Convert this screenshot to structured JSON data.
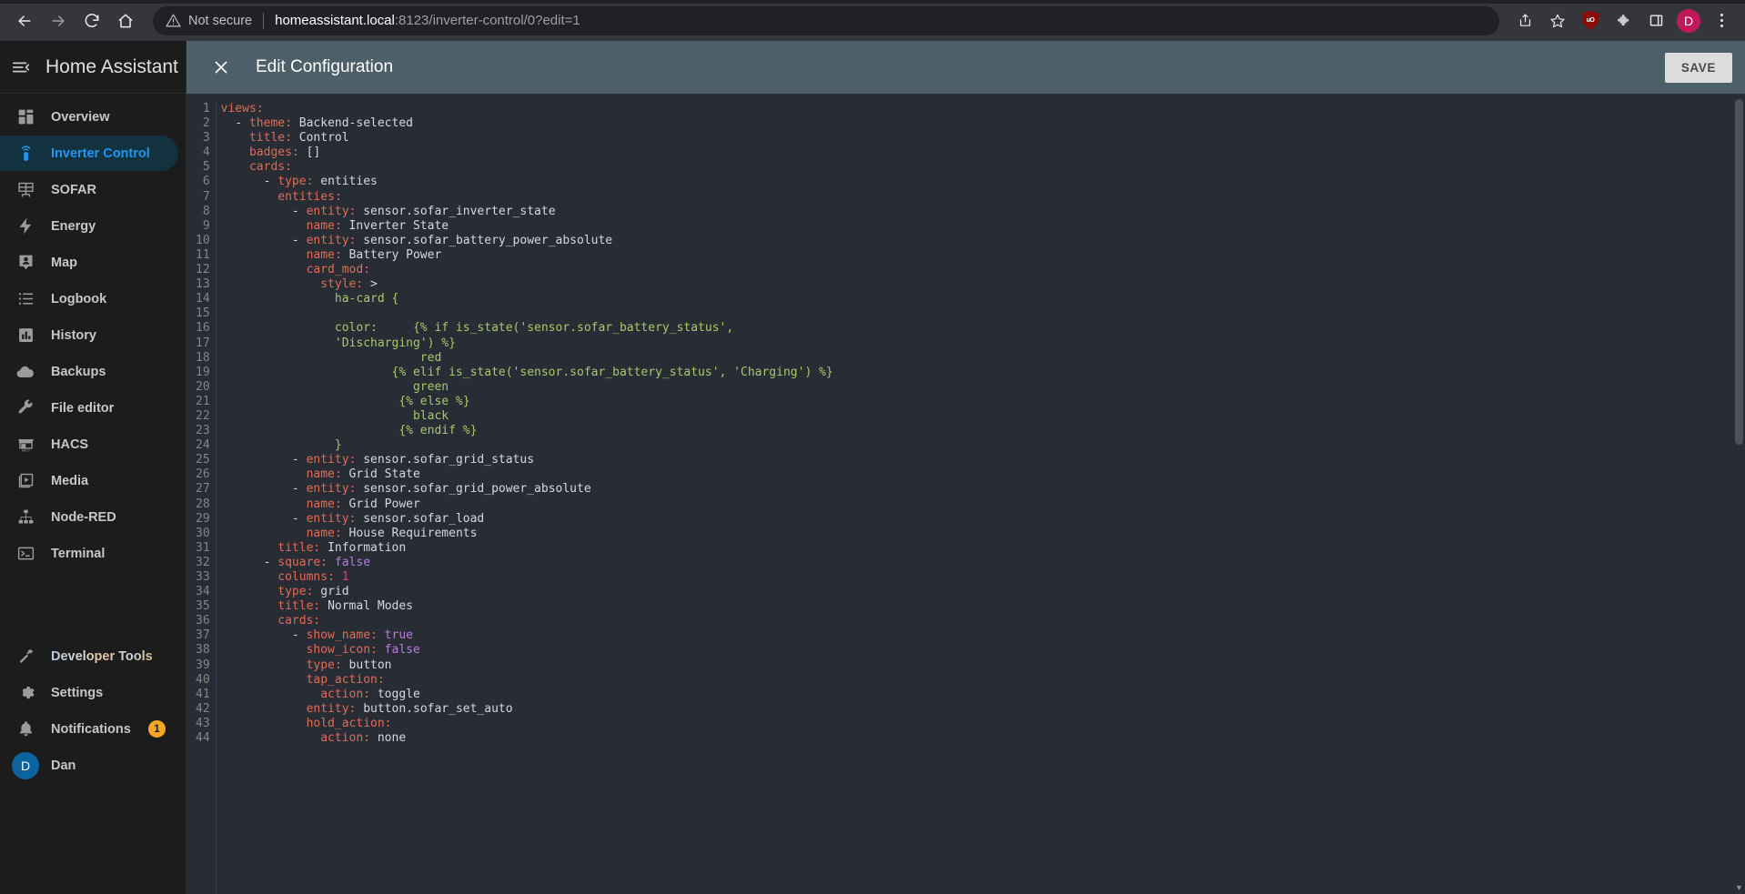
{
  "browser": {
    "back_icon": "arrow-left-icon",
    "forward_icon": "arrow-right-icon",
    "reload_icon": "reload-icon",
    "home_icon": "home-icon",
    "security_label": "Not secure",
    "url_host": "homeassistant.local",
    "url_path": ":8123/inverter-control/0?edit=1",
    "share_icon": "share-icon",
    "bookmark_icon": "star-icon",
    "extension_shield_label": "uO",
    "puzzle_icon": "puzzle-icon",
    "sidepanel_icon": "side-panel-icon",
    "profile_initial": "D",
    "menu_icon": "three-dot-menu-icon"
  },
  "sidebar": {
    "menu_icon": "collapse-menu-icon",
    "title": "Home Assistant",
    "items": [
      {
        "label": "Overview",
        "icon": "view-dashboard-icon",
        "active": false
      },
      {
        "label": "Inverter Control",
        "icon": "remote-icon",
        "active": true
      },
      {
        "label": "SOFAR",
        "icon": "solar-panel-icon",
        "active": false
      },
      {
        "label": "Energy",
        "icon": "lightning-bolt-icon",
        "active": false
      },
      {
        "label": "Map",
        "icon": "account-badge-icon",
        "active": false
      },
      {
        "label": "Logbook",
        "icon": "format-list-icon",
        "active": false
      },
      {
        "label": "History",
        "icon": "chart-box-icon",
        "active": false
      },
      {
        "label": "Backups",
        "icon": "cloud-icon",
        "active": false
      },
      {
        "label": "File editor",
        "icon": "wrench-icon",
        "active": false
      },
      {
        "label": "HACS",
        "icon": "hacs-storefront-icon",
        "active": false
      },
      {
        "label": "Media",
        "icon": "play-box-icon",
        "active": false
      },
      {
        "label": "Node-RED",
        "icon": "sitemap-icon",
        "active": false
      },
      {
        "label": "Terminal",
        "icon": "console-icon",
        "active": false
      }
    ],
    "footer": [
      {
        "label": "Developer Tools",
        "icon": "hammer-icon"
      },
      {
        "label": "Settings",
        "icon": "cog-icon"
      },
      {
        "label": "Notifications",
        "icon": "bell-icon",
        "badge": "1"
      },
      {
        "label": "Dan",
        "icon": "user-avatar",
        "avatar_initial": "D"
      }
    ]
  },
  "toolbar": {
    "close_icon": "close-icon",
    "title": "Edit Configuration",
    "save_label": "SAVE"
  },
  "editor": {
    "first_line": 1,
    "lines": [
      [
        {
          "t": "views:",
          "c": "k"
        }
      ],
      [
        {
          "t": "  - ",
          "c": "p"
        },
        {
          "t": "theme:",
          "c": "k"
        },
        {
          "t": " Backend-selected",
          "c": "v"
        }
      ],
      [
        {
          "t": "    ",
          "c": "p"
        },
        {
          "t": "title:",
          "c": "k"
        },
        {
          "t": " Control",
          "c": "v"
        }
      ],
      [
        {
          "t": "    ",
          "c": "p"
        },
        {
          "t": "badges:",
          "c": "k"
        },
        {
          "t": " []",
          "c": "v"
        }
      ],
      [
        {
          "t": "    ",
          "c": "p"
        },
        {
          "t": "cards:",
          "c": "k"
        }
      ],
      [
        {
          "t": "      - ",
          "c": "p"
        },
        {
          "t": "type:",
          "c": "k"
        },
        {
          "t": " entities",
          "c": "v"
        }
      ],
      [
        {
          "t": "        ",
          "c": "p"
        },
        {
          "t": "entities:",
          "c": "k"
        }
      ],
      [
        {
          "t": "          - ",
          "c": "p"
        },
        {
          "t": "entity:",
          "c": "k"
        },
        {
          "t": " sensor.sofar_inverter_state",
          "c": "v"
        }
      ],
      [
        {
          "t": "            ",
          "c": "p"
        },
        {
          "t": "name:",
          "c": "k"
        },
        {
          "t": " Inverter State",
          "c": "v"
        }
      ],
      [
        {
          "t": "          - ",
          "c": "p"
        },
        {
          "t": "entity:",
          "c": "k"
        },
        {
          "t": " sensor.sofar_battery_power_absolute",
          "c": "v"
        }
      ],
      [
        {
          "t": "            ",
          "c": "p"
        },
        {
          "t": "name:",
          "c": "k"
        },
        {
          "t": " Battery Power",
          "c": "v"
        }
      ],
      [
        {
          "t": "            ",
          "c": "p"
        },
        {
          "t": "card_mod:",
          "c": "k"
        }
      ],
      [
        {
          "t": "              ",
          "c": "p"
        },
        {
          "t": "style:",
          "c": "k"
        },
        {
          "t": " >",
          "c": "v"
        }
      ],
      [
        {
          "t": "                ha-card {",
          "c": "s"
        }
      ],
      [
        {
          "t": "",
          "c": "s"
        }
      ],
      [
        {
          "t": "                color:     {% if is_state('sensor.sofar_battery_status',",
          "c": "s"
        }
      ],
      [
        {
          "t": "                'Discharging') %}",
          "c": "s"
        }
      ],
      [
        {
          "t": "                            red",
          "c": "s"
        }
      ],
      [
        {
          "t": "                        {% elif is_state('sensor.sofar_battery_status', 'Charging') %}",
          "c": "s"
        }
      ],
      [
        {
          "t": "                           green",
          "c": "s"
        }
      ],
      [
        {
          "t": "                         {% else %}",
          "c": "s"
        }
      ],
      [
        {
          "t": "                           black",
          "c": "s"
        }
      ],
      [
        {
          "t": "                         {% endif %}",
          "c": "s"
        }
      ],
      [
        {
          "t": "                }",
          "c": "s"
        }
      ],
      [
        {
          "t": "          - ",
          "c": "p"
        },
        {
          "t": "entity:",
          "c": "k"
        },
        {
          "t": " sensor.sofar_grid_status",
          "c": "v"
        }
      ],
      [
        {
          "t": "            ",
          "c": "p"
        },
        {
          "t": "name:",
          "c": "k"
        },
        {
          "t": " Grid State",
          "c": "v"
        }
      ],
      [
        {
          "t": "          - ",
          "c": "p"
        },
        {
          "t": "entity:",
          "c": "k"
        },
        {
          "t": " sensor.sofar_grid_power_absolute",
          "c": "v"
        }
      ],
      [
        {
          "t": "            ",
          "c": "p"
        },
        {
          "t": "name:",
          "c": "k"
        },
        {
          "t": " Grid Power",
          "c": "v"
        }
      ],
      [
        {
          "t": "          - ",
          "c": "p"
        },
        {
          "t": "entity:",
          "c": "k"
        },
        {
          "t": " sensor.sofar_load",
          "c": "v"
        }
      ],
      [
        {
          "t": "            ",
          "c": "p"
        },
        {
          "t": "name:",
          "c": "k"
        },
        {
          "t": " House Requirements",
          "c": "v"
        }
      ],
      [
        {
          "t": "        ",
          "c": "p"
        },
        {
          "t": "title:",
          "c": "k"
        },
        {
          "t": " Information",
          "c": "v"
        }
      ],
      [
        {
          "t": "      - ",
          "c": "p"
        },
        {
          "t": "square:",
          "c": "k"
        },
        {
          "t": " false",
          "c": "b"
        }
      ],
      [
        {
          "t": "        ",
          "c": "p"
        },
        {
          "t": "columns:",
          "c": "k"
        },
        {
          "t": " 1",
          "c": "n"
        }
      ],
      [
        {
          "t": "        ",
          "c": "p"
        },
        {
          "t": "type:",
          "c": "k"
        },
        {
          "t": " grid",
          "c": "v"
        }
      ],
      [
        {
          "t": "        ",
          "c": "p"
        },
        {
          "t": "title:",
          "c": "k"
        },
        {
          "t": " Normal Modes",
          "c": "v"
        }
      ],
      [
        {
          "t": "        ",
          "c": "p"
        },
        {
          "t": "cards:",
          "c": "k"
        }
      ],
      [
        {
          "t": "          - ",
          "c": "p"
        },
        {
          "t": "show_name:",
          "c": "k"
        },
        {
          "t": " true",
          "c": "b"
        }
      ],
      [
        {
          "t": "            ",
          "c": "p"
        },
        {
          "t": "show_icon:",
          "c": "k"
        },
        {
          "t": " false",
          "c": "b"
        }
      ],
      [
        {
          "t": "            ",
          "c": "p"
        },
        {
          "t": "type:",
          "c": "k"
        },
        {
          "t": " button",
          "c": "v"
        }
      ],
      [
        {
          "t": "            ",
          "c": "p"
        },
        {
          "t": "tap_action:",
          "c": "k"
        }
      ],
      [
        {
          "t": "              ",
          "c": "p"
        },
        {
          "t": "action:",
          "c": "k"
        },
        {
          "t": " toggle",
          "c": "v"
        }
      ],
      [
        {
          "t": "            ",
          "c": "p"
        },
        {
          "t": "entity:",
          "c": "k"
        },
        {
          "t": " button.sofar_set_auto",
          "c": "v"
        }
      ],
      [
        {
          "t": "            ",
          "c": "p"
        },
        {
          "t": "hold_action:",
          "c": "k"
        }
      ],
      [
        {
          "t": "              ",
          "c": "p"
        },
        {
          "t": "action:",
          "c": "k"
        },
        {
          "t": " none",
          "c": "v"
        }
      ]
    ]
  },
  "colors": {
    "accent": "#2196f3",
    "toolbar_bg": "#4d6069",
    "editor_bg": "#282c34",
    "sidebar_bg": "#1c1c1c",
    "badge": "#f5a623",
    "yaml_key": "#e06c56",
    "yaml_string": "#a8c86a",
    "yaml_boolean": "#b57edc",
    "yaml_number": "#e0416b"
  }
}
